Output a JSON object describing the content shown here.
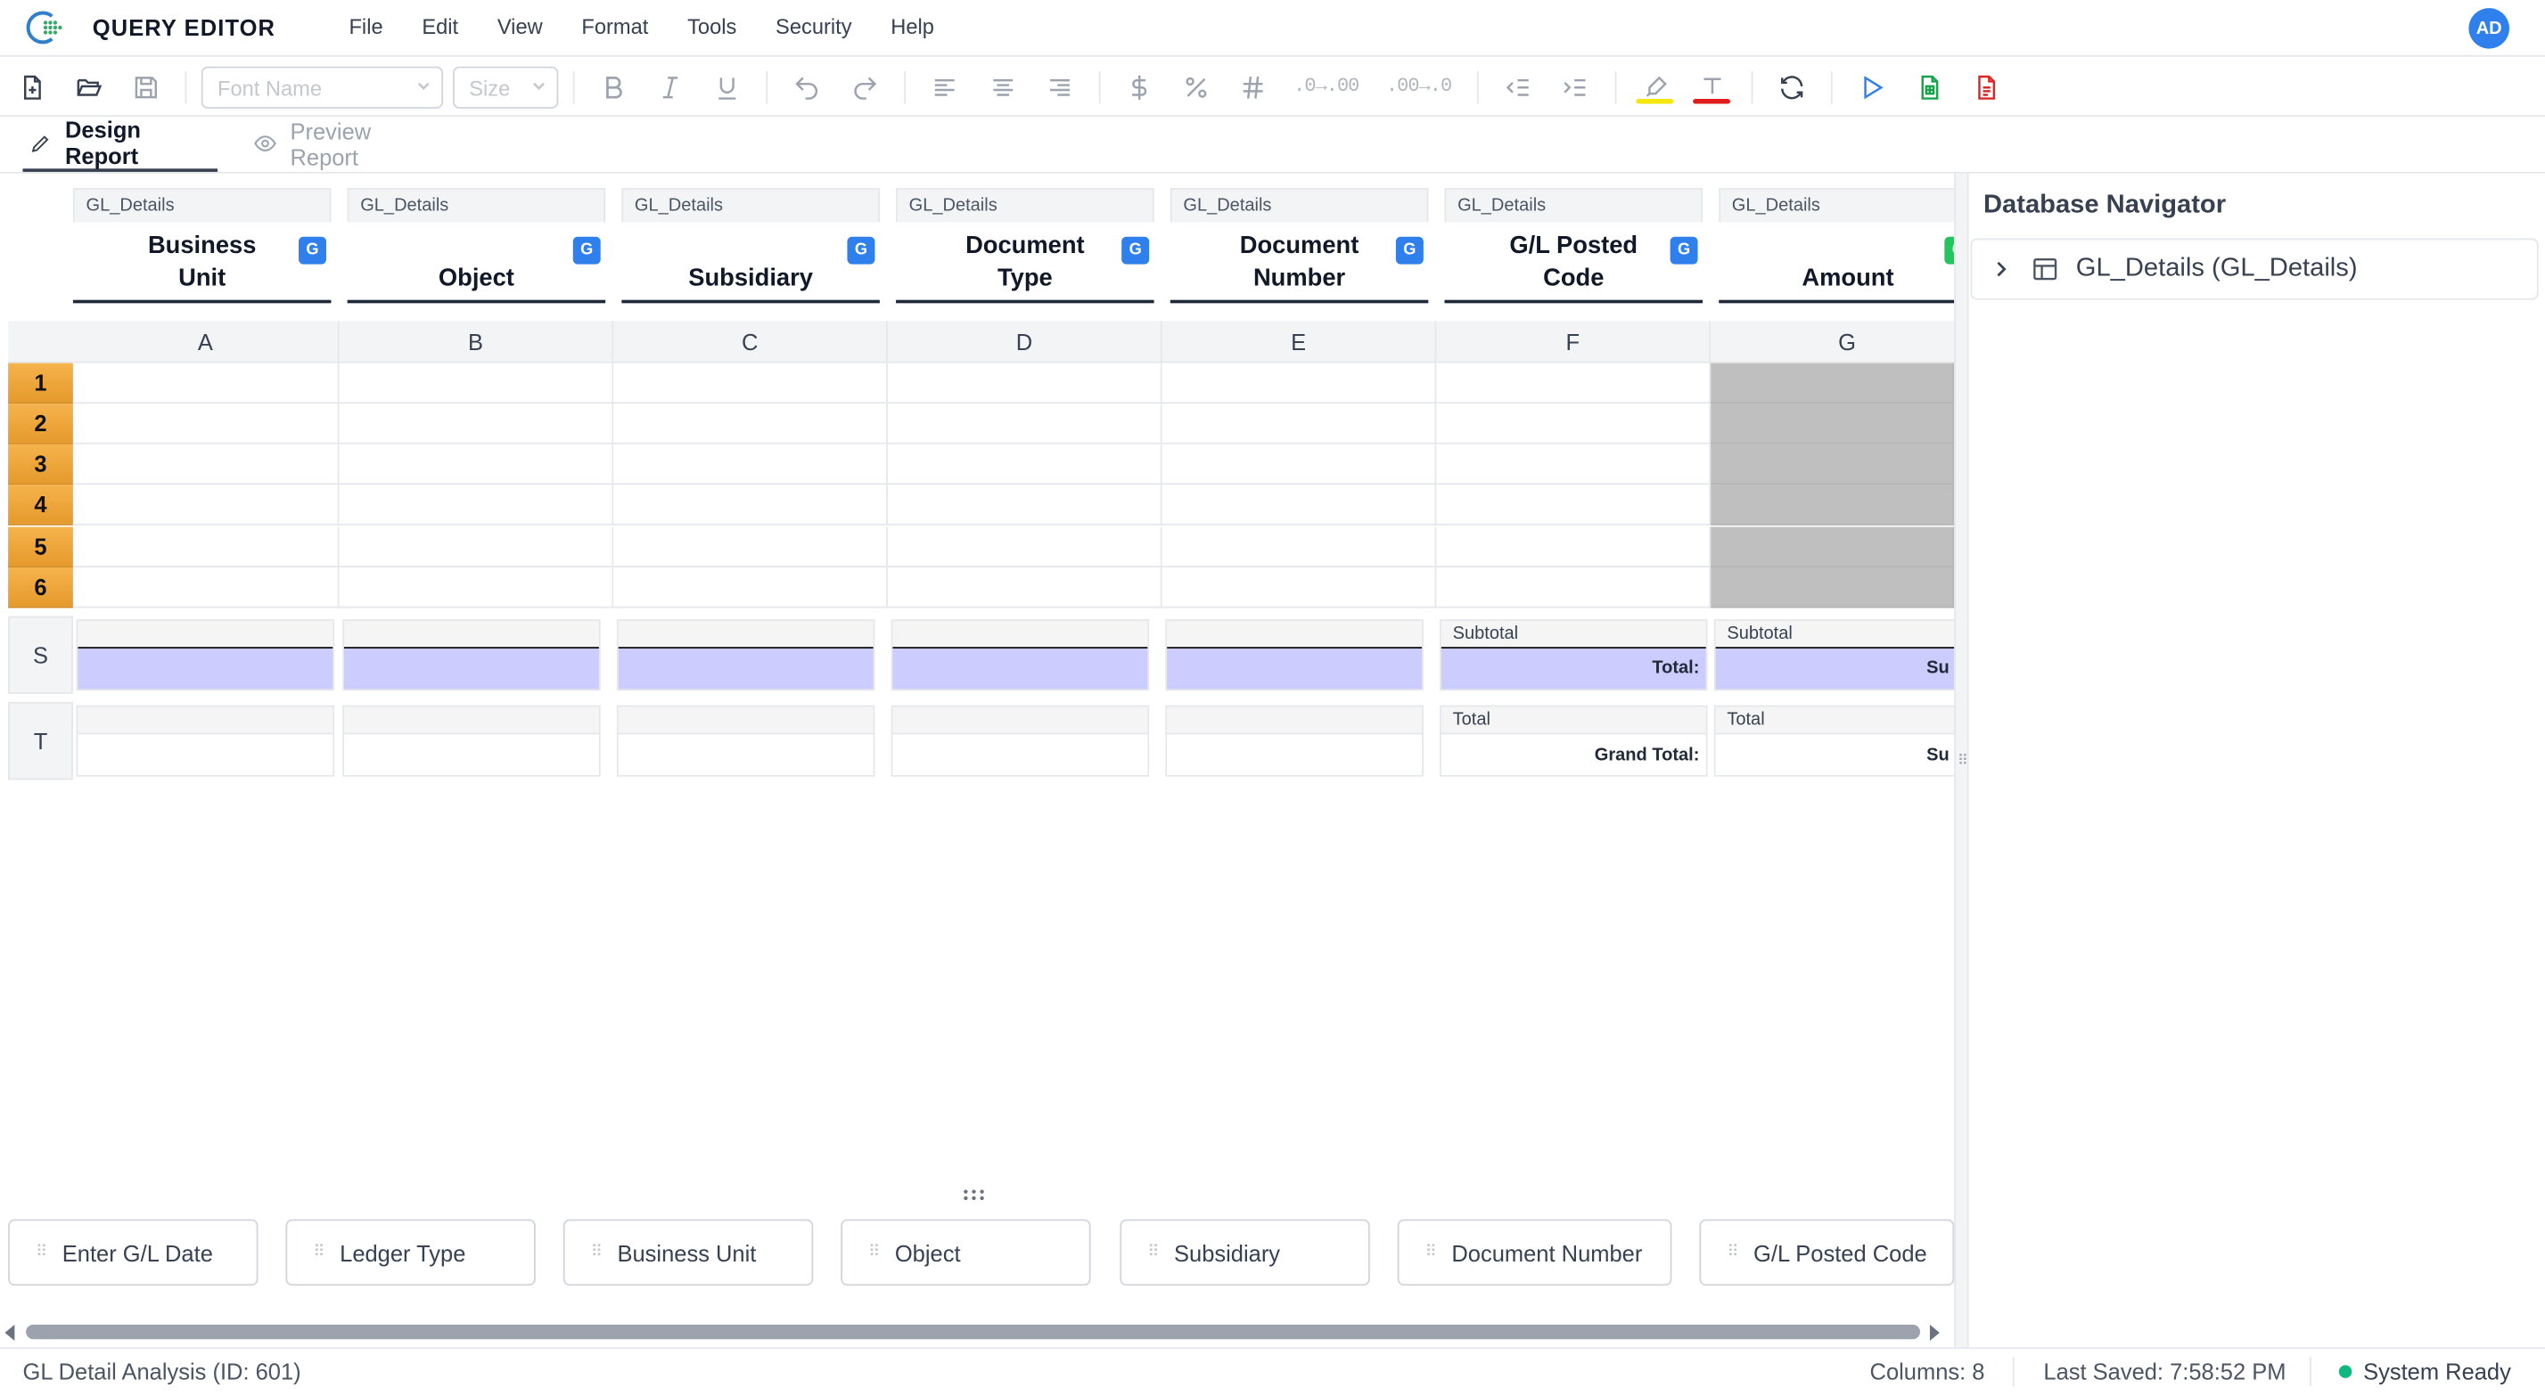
{
  "app": {
    "title": "QUERY EDITOR",
    "user_initials": "AD"
  },
  "menu": [
    "File",
    "Edit",
    "View",
    "Format",
    "Tools",
    "Security",
    "Help"
  ],
  "toolbar": {
    "font_placeholder": "Font Name",
    "size_placeholder": "Size",
    "increase_decimal": ".0→.00",
    "decrease_decimal": ".00→.0",
    "highlight_color": "#f5e60a",
    "text_color": "#e11d1d"
  },
  "tabs": [
    {
      "label": "Design Report",
      "active": true
    },
    {
      "label": "Preview Report",
      "active": false
    }
  ],
  "columns": [
    {
      "letter": "A",
      "table": "GL_Details",
      "name": "Business Unit"
    },
    {
      "letter": "B",
      "table": "GL_Details",
      "name": "Object"
    },
    {
      "letter": "C",
      "table": "GL_Details",
      "name": "Subsidiary"
    },
    {
      "letter": "D",
      "table": "GL_Details",
      "name": "Document Type"
    },
    {
      "letter": "E",
      "table": "GL_Details",
      "name": "Document Number"
    },
    {
      "letter": "F",
      "table": "GL_Details",
      "name": "G/L Posted Code"
    },
    {
      "letter": "G",
      "table": "GL_Details",
      "name": "Amount"
    }
  ],
  "group_badge": "G",
  "rows": [
    "1",
    "2",
    "3",
    "4",
    "5",
    "6"
  ],
  "bands": {
    "subtotal": {
      "side": "S",
      "label": "Subtotal",
      "total_text": "Total:",
      "cut_text": "Su"
    },
    "total": {
      "side": "T",
      "label": "Total",
      "total_text": "Grand Total:",
      "cut_text": "Su"
    }
  },
  "filters": [
    "Enter G/L Date",
    "Ledger Type",
    "Business Unit",
    "Object",
    "Subsidiary",
    "Document Number",
    "G/L Posted Code"
  ],
  "navigator": {
    "title": "Database Navigator",
    "items": [
      "GL_Details (GL_Details)"
    ]
  },
  "status": {
    "report": "GL Detail Analysis (ID: 601)",
    "columns": "Columns: 8",
    "last_saved": "Last Saved: 7:58:52 PM",
    "state": "System Ready"
  }
}
